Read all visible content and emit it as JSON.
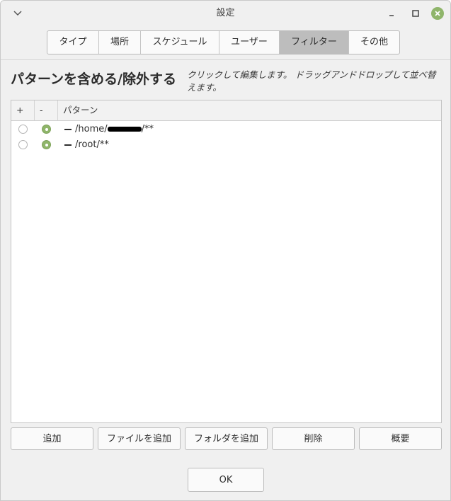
{
  "window": {
    "title": "設定"
  },
  "tabs": [
    {
      "label": "タイプ",
      "active": false
    },
    {
      "label": "場所",
      "active": false
    },
    {
      "label": "スケジュール",
      "active": false
    },
    {
      "label": "ユーザー",
      "active": false
    },
    {
      "label": "フィルター",
      "active": true
    },
    {
      "label": "その他",
      "active": false
    }
  ],
  "section": {
    "heading": "パターンを含める/除外する",
    "hint": "クリックして編集します。 ドラッグアンドドロップして並べ替えます。"
  },
  "pattern_list": {
    "columns": [
      "+",
      "-",
      "パターン"
    ],
    "rows": [
      {
        "include": false,
        "exclude": true,
        "pattern_prefix": "/home/",
        "pattern_suffix": "/**",
        "redacted": true
      },
      {
        "include": false,
        "exclude": true,
        "pattern_prefix": "/root/**",
        "pattern_suffix": "",
        "redacted": false
      }
    ]
  },
  "buttons": {
    "add": "追加",
    "add_file": "ファイルを追加",
    "add_folder": "フォルダを追加",
    "delete": "削除",
    "summary": "概要",
    "ok": "OK"
  },
  "colors": {
    "accent": "#8fb56a",
    "active_tab": "#bdbdbd"
  },
  "icons": {
    "window_menu": "chevron-down-icon",
    "minimize": "minimize-icon",
    "maximize": "maximize-icon",
    "close": "close-icon"
  }
}
